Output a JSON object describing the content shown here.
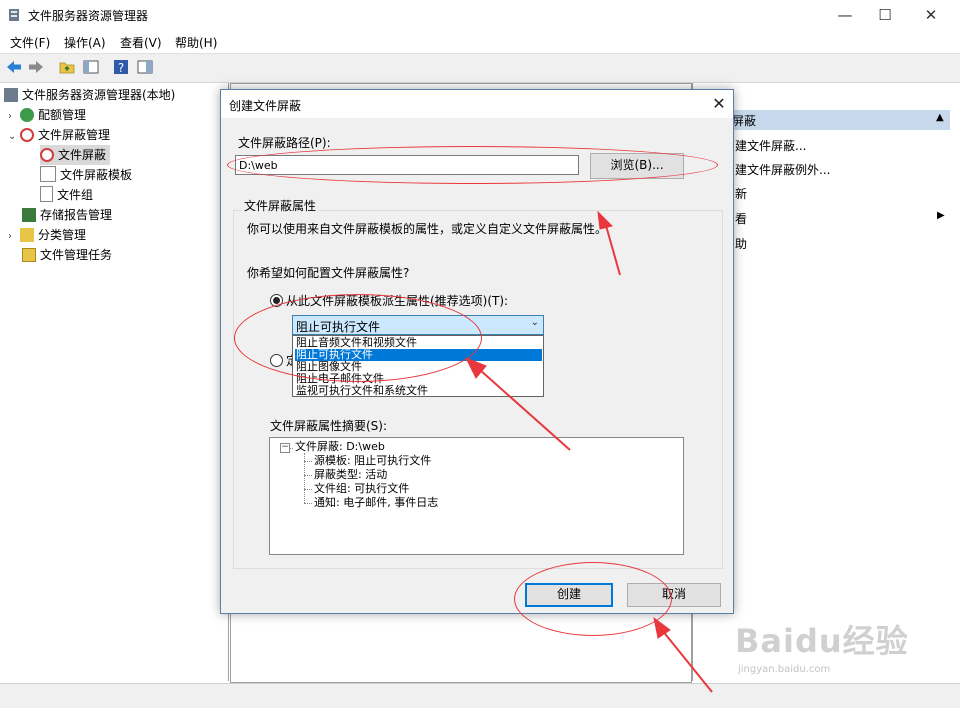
{
  "window": {
    "title": "文件服务器资源管理器",
    "controls": {
      "minimize": "—",
      "maximize": "☐",
      "close": "✕"
    }
  },
  "menu": [
    "文件(F)",
    "操作(A)",
    "查看(V)",
    "帮助(H)"
  ],
  "tree": {
    "root": "文件服务器资源管理器(本地)",
    "items": [
      {
        "label": "配额管理",
        "icon": "quota-icon"
      },
      {
        "label": "文件屏蔽管理",
        "icon": "file-screen-management-icon"
      },
      {
        "label": "文件屏蔽",
        "icon": "file-screen-icon"
      },
      {
        "label": "文件屏蔽模板",
        "icon": "file-screen-template-icon"
      },
      {
        "label": "文件组",
        "icon": "file-group-icon"
      },
      {
        "label": "存储报告管理",
        "icon": "storage-report-icon"
      },
      {
        "label": "分类管理",
        "icon": "classification-icon"
      },
      {
        "label": "文件管理任务",
        "icon": "file-management-task-icon"
      }
    ]
  },
  "actions": {
    "header": "屏蔽",
    "items": [
      "建文件屏蔽...",
      "建文件屏蔽例外...",
      "新",
      "看",
      "助"
    ]
  },
  "dialog": {
    "title": "创建文件屏蔽",
    "path_label": "文件屏蔽路径(P):",
    "path_value": "D:\\web",
    "browse_label": "浏览(B)...",
    "group_title": "文件屏蔽属性",
    "description": "你可以使用来自文件屏蔽模板的属性，或定义自定义文件屏蔽属性。",
    "question": "你希望如何配置文件屏蔽属性?",
    "radio1_label": "从此文件屏蔽模板派生属性(推荐选项)(T):",
    "radio2_label": "定",
    "combo_value": "阻止可执行文件",
    "dropdown_options": [
      "阻止音频文件和视频文件",
      "阻止可执行文件",
      "阻止图像文件",
      "阻止电子邮件文件",
      "监视可执行文件和系统文件"
    ],
    "selected_index": 1,
    "summary_label": "文件屏蔽属性摘要(S):",
    "summary_root": "文件屏蔽: D:\\web",
    "summary_items": [
      "源模板: 阻止可执行文件",
      "屏蔽类型: 活动",
      "文件组: 可执行文件",
      "通知: 电子邮件, 事件日志"
    ],
    "create_label": "创建",
    "cancel_label": "取消",
    "close_glyph": "✕"
  },
  "watermark": {
    "text": "Baidu经验",
    "sub": "jingyan.baidu.com"
  },
  "colors": {
    "annotation_red": "#e8383d",
    "selection_blue": "#0078d7",
    "actions_header": "#c8d8ec"
  }
}
